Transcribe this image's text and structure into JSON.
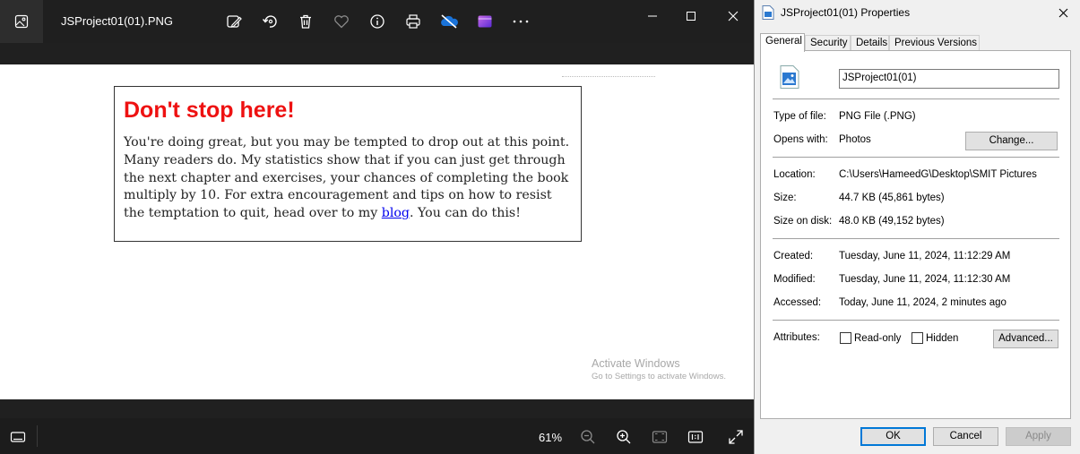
{
  "viewer": {
    "file_title": "JSProject01(01).PNG",
    "zoom": "61%",
    "image": {
      "heading": "Don't stop here!",
      "body_before_link": "You're doing great, but you may be tempted to drop out at this point. Many readers do. My statistics show that if you can just get through the next chapter and exercises, your chances of completing the book multiply by 10. For extra encouragement and tips on how to resist the temptation to quit, head over to my ",
      "link_text": "blog",
      "body_after_link": ". You can do this!"
    },
    "watermark": {
      "line1": "Activate Windows",
      "line2": "Go to Settings to activate Windows."
    },
    "toolbar_icons": [
      "edit-image-icon",
      "rotate-icon",
      "delete-icon",
      "favorite-heart-icon",
      "info-icon",
      "print-icon",
      "onedrive-icon",
      "clipchamp-icon",
      "more-icon"
    ],
    "colors": {
      "heading": "#ee1111",
      "link": "#0000ee",
      "chrome": "#202020"
    }
  },
  "dialog": {
    "title": "JSProject01(01) Properties",
    "tabs": [
      "General",
      "Security",
      "Details",
      "Previous Versions"
    ],
    "file_name": "JSProject01(01)",
    "type_label": "Type of file:",
    "type_value": "PNG File (.PNG)",
    "opens_label": "Opens with:",
    "opens_value": "Photos",
    "change_button": "Change...",
    "location_label": "Location:",
    "location_value": "C:\\Users\\HameedG\\Desktop\\SMIT Pictures",
    "size_label": "Size:",
    "size_value": "44.7 KB (45,861 bytes)",
    "size_disk_label": "Size on disk:",
    "size_disk_value": "48.0 KB (49,152 bytes)",
    "created_label": "Created:",
    "created_value": "Tuesday, June 11, 2024, 11:12:29 AM",
    "modified_label": "Modified:",
    "modified_value": "Tuesday, June 11, 2024, 11:12:30 AM",
    "accessed_label": "Accessed:",
    "accessed_value": "Today, June 11, 2024, 2 minutes ago",
    "attributes_label": "Attributes:",
    "readonly_label": "Read-only",
    "hidden_label": "Hidden",
    "advanced_button": "Advanced...",
    "ok_button": "OK",
    "cancel_button": "Cancel",
    "apply_button": "Apply"
  }
}
